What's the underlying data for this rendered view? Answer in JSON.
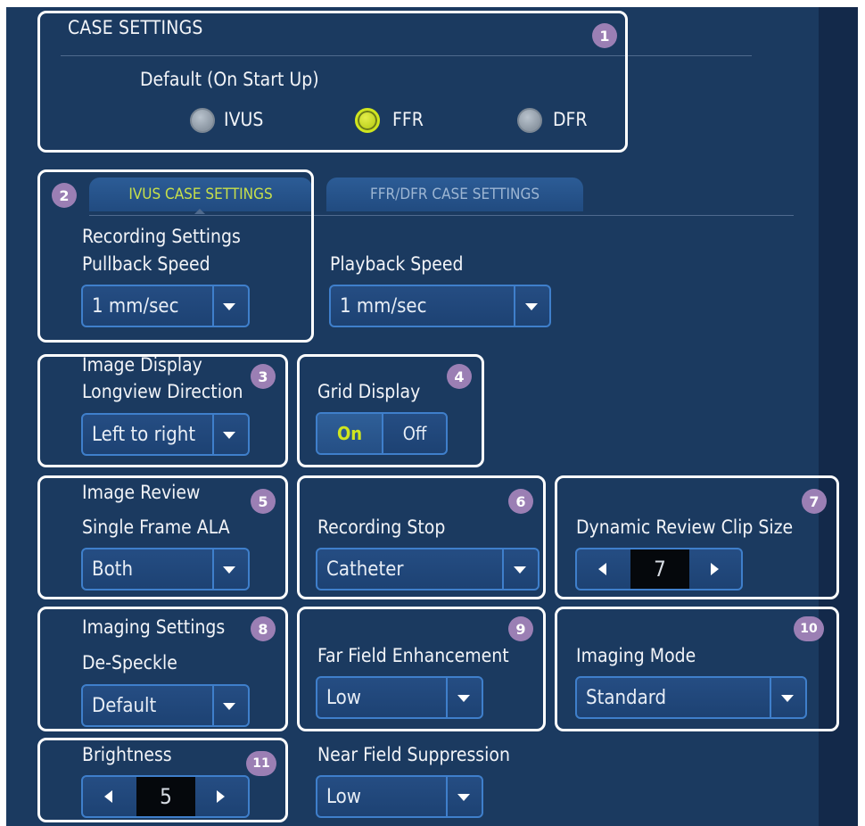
{
  "case_settings": {
    "title": "CASE SETTINGS",
    "default_label": "Default (On Start Up)",
    "options": [
      "IVUS",
      "FFR",
      "DFR"
    ],
    "selected": "FFR"
  },
  "tabs": [
    {
      "label": "IVUS CASE SETTINGS",
      "active": true
    },
    {
      "label": "FFR/DFR CASE SETTINGS",
      "active": false
    }
  ],
  "recording": {
    "section_label": "Recording Settings",
    "pullback_label": "Pullback Speed",
    "pullback_value": "1 mm/sec",
    "playback_label": "Playback Speed",
    "playback_value": "1 mm/sec"
  },
  "image_display": {
    "section_label": "Image Display",
    "longview_label": "Longview Direction",
    "longview_value": "Left to right",
    "grid_label": "Grid Display",
    "grid_on": "On",
    "grid_off": "Off",
    "grid_selected": "On"
  },
  "image_review": {
    "section_label": "Image Review",
    "single_frame_label": "Single Frame ALA",
    "single_frame_value": "Both",
    "recording_stop_label": "Recording Stop",
    "recording_stop_value": "Catheter",
    "clip_size_label": "Dynamic Review Clip Size",
    "clip_size_value": "7"
  },
  "imaging": {
    "section_label": "Imaging Settings",
    "despeckle_label": "De-Speckle",
    "despeckle_value": "Default",
    "far_field_label": "Far Field Enhancement",
    "far_field_value": "Low",
    "mode_label": "Imaging Mode",
    "mode_value": "Standard",
    "brightness_label": "Brightness",
    "brightness_value": "5",
    "near_field_label": "Near Field Suppression",
    "near_field_value": "Low"
  },
  "badges": [
    "1",
    "2",
    "3",
    "4",
    "5",
    "6",
    "7",
    "8",
    "9",
    "10",
    "11"
  ],
  "colors": {
    "background": "#1b3a60",
    "accent_green": "#cfe51f",
    "control_border": "#3f7fcb",
    "badge": "#9b7fb4"
  }
}
